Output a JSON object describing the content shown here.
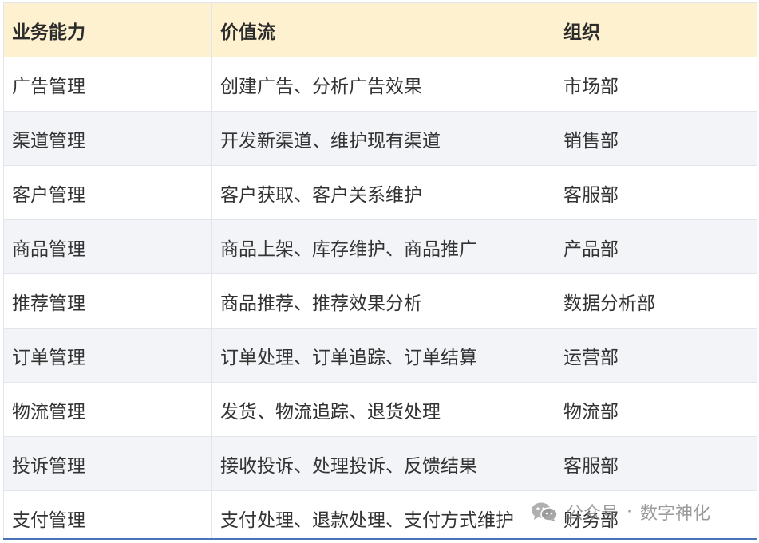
{
  "table": {
    "headers": [
      "业务能力",
      "价值流",
      "组织"
    ],
    "rows": [
      [
        "广告管理",
        "创建广告、分析广告效果",
        "市场部"
      ],
      [
        "渠道管理",
        "开发新渠道、维护现有渠道",
        "销售部"
      ],
      [
        "客户管理",
        "客户获取、客户关系维护",
        "客服部"
      ],
      [
        "商品管理",
        "商品上架、库存维护、商品推广",
        "产品部"
      ],
      [
        "推荐管理",
        "商品推荐、推荐效果分析",
        "数据分析部"
      ],
      [
        "订单管理",
        "订单处理、订单追踪、订单结算",
        "运营部"
      ],
      [
        "物流管理",
        "发货、物流追踪、退货处理",
        "物流部"
      ],
      [
        "投诉管理",
        "接收投诉、处理投诉、反馈结果",
        "客服部"
      ],
      [
        "支付管理",
        "支付处理、退款处理、支付方式维护",
        "财务部"
      ]
    ]
  },
  "watermark": {
    "prefix": "公众号",
    "separator": "·",
    "name": "数字神化",
    "icon": "wechat-icon"
  },
  "colors": {
    "header_bg": "#fdf1cf",
    "row_alt_bg": "#f2f4f7",
    "grid_line": "#e2e6ec",
    "bottom_line": "#4a74b8"
  }
}
